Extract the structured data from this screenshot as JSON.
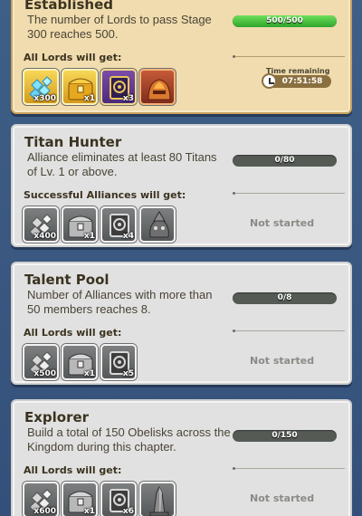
{
  "achievements": [
    {
      "title": "Established",
      "description": "The number of Lords to pass Stage 300 reaches 500.",
      "reward_label": "All Lords will get:",
      "progress_text": "500/500",
      "progress_fraction": 1.0,
      "time_label": "Time remaining",
      "time_value": "07:51:58",
      "rewards": [
        {
          "icon": "diamonds-icon",
          "qty": "x300"
        },
        {
          "icon": "gold-chest-icon",
          "qty": "x1"
        },
        {
          "icon": "purple-token-icon",
          "qty": "x3"
        },
        {
          "icon": "fire-helmet-icon",
          "qty": ""
        }
      ]
    },
    {
      "title": "Titan Hunter",
      "description": "Alliance eliminates at least 80 Titans of Lv. 1 or above.",
      "reward_label": "Successful Alliances will get:",
      "progress_text": "0/80",
      "progress_fraction": 0,
      "status": "Not started",
      "rewards": [
        {
          "icon": "diamonds-icon",
          "qty": "x400"
        },
        {
          "icon": "chest-icon",
          "qty": "x1"
        },
        {
          "icon": "token-icon",
          "qty": "x4"
        },
        {
          "icon": "goblin-icon",
          "qty": ""
        }
      ]
    },
    {
      "title": "Talent Pool",
      "description": "Number of Alliances with more than 50 members reaches 8.",
      "reward_label": "All Lords will get:",
      "progress_text": "0/8",
      "progress_fraction": 0,
      "status": "Not started",
      "rewards": [
        {
          "icon": "diamonds-icon",
          "qty": "x500"
        },
        {
          "icon": "chest-icon",
          "qty": "x1"
        },
        {
          "icon": "token-icon",
          "qty": "x5"
        }
      ]
    },
    {
      "title": "Explorer",
      "description": "Build a total of 150 Obelisks across the Kingdom during this chapter.",
      "reward_label": "All Lords will get:",
      "progress_text": "0/150",
      "progress_fraction": 0,
      "status": "Not started",
      "rewards": [
        {
          "icon": "diamonds-icon",
          "qty": "x600"
        },
        {
          "icon": "chest-icon",
          "qty": "x1"
        },
        {
          "icon": "token-icon",
          "qty": "x6"
        },
        {
          "icon": "obelisk-icon",
          "qty": ""
        }
      ]
    }
  ]
}
